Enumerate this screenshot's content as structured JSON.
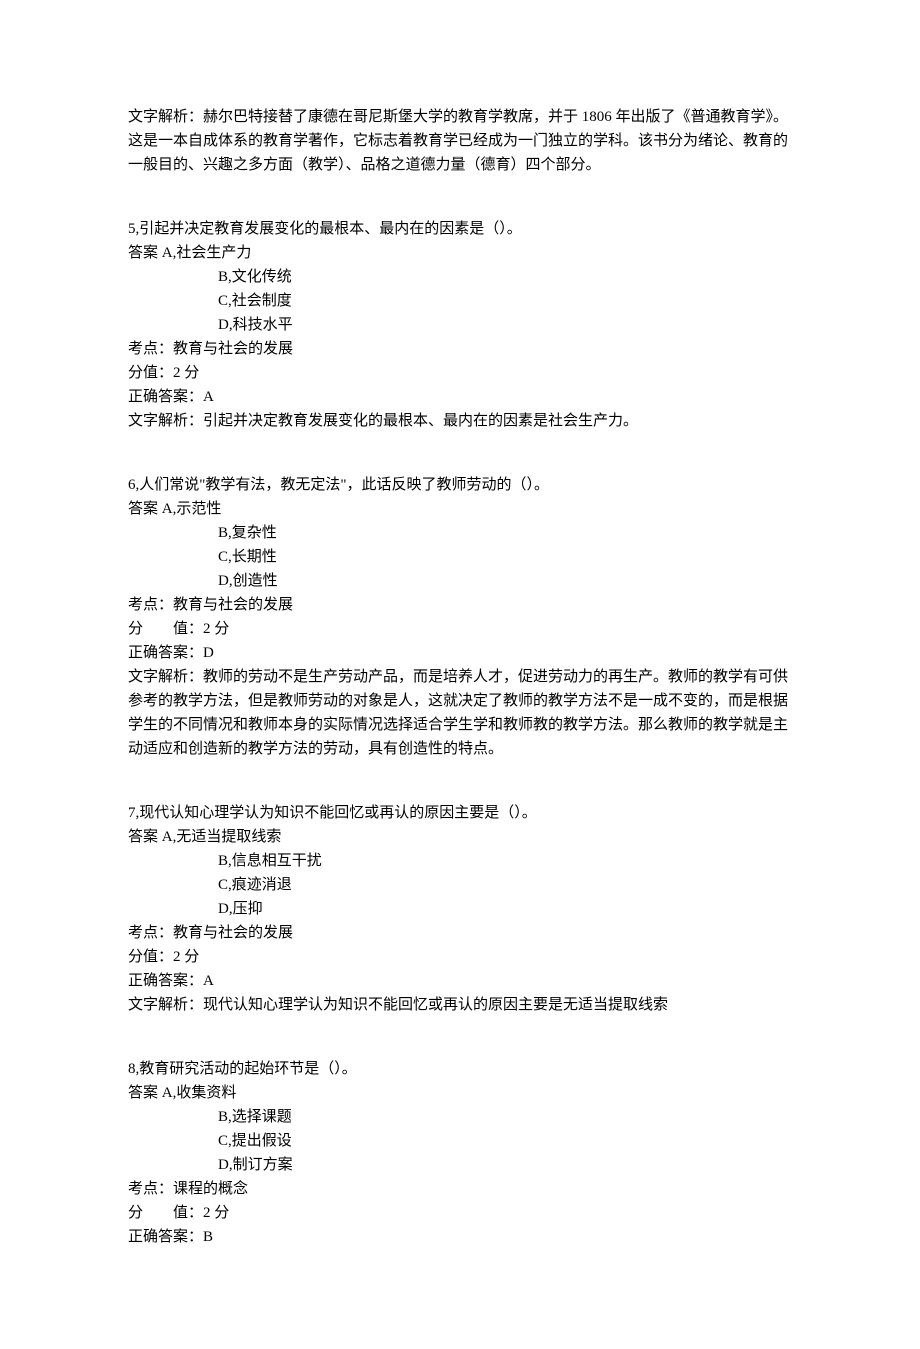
{
  "q4": {
    "explanation": "文字解析：赫尔巴特接替了康德在哥尼斯堡大学的教育学教席，并于 1806 年出版了《普通教育学》。这是一本自成体系的教育学著作，它标志着教育学已经成为一门独立的学科。该书分为绪论、教育的一般目的、兴趣之多方面（教学）、品格之道德力量（德育）四个部分。"
  },
  "q5": {
    "stem": "5,引起并决定教育发展变化的最根本、最内在的因素是（）。",
    "optA": "答案 A,社会生产力",
    "optB": "B,文化传统",
    "optC": "C,社会制度",
    "optD": "D,科技水平",
    "topic": "考点：教育与社会的发展",
    "score": "分值：2 分",
    "correct": "正确答案：A",
    "explanation": "文字解析：引起并决定教育发展变化的最根本、最内在的因素是社会生产力。"
  },
  "q6": {
    "stem": "6,人们常说\"教学有法，教无定法\"，此话反映了教师劳动的（）。",
    "optA": "答案 A,示范性",
    "optB": "B,复杂性",
    "optC": "C,长期性",
    "optD": "D,创造性",
    "topic": "考点：教育与社会的发展",
    "score": "分　　值：2 分",
    "correct": "正确答案：D",
    "explanation": "文字解析：教师的劳动不是生产劳动产品，而是培养人才，促进劳动力的再生产。教师的教学有可供参考的教学方法，但是教师劳动的对象是人，这就决定了教师的教学方法不是一成不变的，而是根据学生的不同情况和教师本身的实际情况选择适合学生学和教师教的教学方法。那么教师的教学就是主动适应和创造新的教学方法的劳动，具有创造性的特点。"
  },
  "q7": {
    "stem": "7,现代认知心理学认为知识不能回忆或再认的原因主要是（）。",
    "optA": "答案 A,无适当提取线索",
    "optB": "B,信息相互干扰",
    "optC": "C,痕迹消退",
    "optD": "D,压抑",
    "topic": "考点：教育与社会的发展",
    "score": "分值：2 分",
    "correct": "正确答案：A",
    "explanation": "文字解析：现代认知心理学认为知识不能回忆或再认的原因主要是无适当提取线索"
  },
  "q8": {
    "stem": "8,教育研究活动的起始环节是（）。",
    "optA": "答案 A,收集资料",
    "optB": "B,选择课题",
    "optC": "C,提出假设",
    "optD": "D,制订方案",
    "topic": "考点：课程的概念",
    "score": "分　　值：2 分",
    "correct": "正确答案：B"
  }
}
